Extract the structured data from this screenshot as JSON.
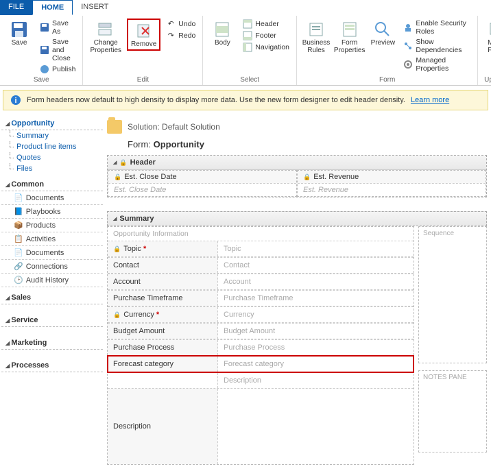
{
  "tabs": {
    "file": "FILE",
    "home": "HOME",
    "insert": "INSERT"
  },
  "ribbon": {
    "save": {
      "save": "Save",
      "saveAs": "Save As",
      "saveAndClose": "Save and Close",
      "publish": "Publish",
      "group": "Save"
    },
    "edit": {
      "changeProps": "Change\nProperties",
      "remove": "Remove",
      "undo": "Undo",
      "redo": "Redo",
      "group": "Edit"
    },
    "select": {
      "body": "Body",
      "header": "Header",
      "footer": "Footer",
      "navigation": "Navigation",
      "group": "Select"
    },
    "form": {
      "businessRules": "Business\nRules",
      "formProps": "Form\nProperties",
      "preview": "Preview",
      "enableSecurity": "Enable Security Roles",
      "showDeps": "Show Dependencies",
      "managedProps": "Managed Properties",
      "group": "Form"
    },
    "upgrade": {
      "mergeForms": "Merge\nForms",
      "group": "Upgrade"
    }
  },
  "info": {
    "text": "Form headers now default to high density to display more data. Use the new form designer to edit header density.",
    "link": "Learn more"
  },
  "sidebar": {
    "opportunity": {
      "title": "Opportunity",
      "items": [
        "Summary",
        "Product line items",
        "Quotes",
        "Files"
      ]
    },
    "common": {
      "title": "Common",
      "items": [
        "Documents",
        "Playbooks",
        "Products",
        "Activities",
        "Documents",
        "Connections",
        "Audit History"
      ]
    },
    "sales": {
      "title": "Sales"
    },
    "service": {
      "title": "Service"
    },
    "marketing": {
      "title": "Marketing"
    },
    "processes": {
      "title": "Processes"
    }
  },
  "content": {
    "solutionLabel": "Solution: Default Solution",
    "formPrefix": "Form:",
    "formName": "Opportunity",
    "header": {
      "title": "Header",
      "closeDate": "Est. Close Date",
      "closeDatePh": "Est. Close Date",
      "revenue": "Est. Revenue",
      "revenuePh": "Est. Revenue"
    },
    "summary": {
      "title": "Summary",
      "infoLabel": "Opportunity Information",
      "sequence": "Sequence",
      "notesPane": "NOTES PANE",
      "fields": [
        {
          "label": "Topic",
          "ph": "Topic",
          "lock": true,
          "req": true
        },
        {
          "label": "Contact",
          "ph": "Contact"
        },
        {
          "label": "Account",
          "ph": "Account"
        },
        {
          "label": "Purchase Timeframe",
          "ph": "Purchase Timeframe"
        },
        {
          "label": "Currency",
          "ph": "Currency",
          "lock": true,
          "req": true
        },
        {
          "label": "Budget Amount",
          "ph": "Budget Amount"
        },
        {
          "label": "Purchase Process",
          "ph": "Purchase Process"
        },
        {
          "label": "Forecast category",
          "ph": "Forecast category",
          "selected": true
        }
      ],
      "description": {
        "label": "Description",
        "ph": "Description"
      }
    }
  }
}
